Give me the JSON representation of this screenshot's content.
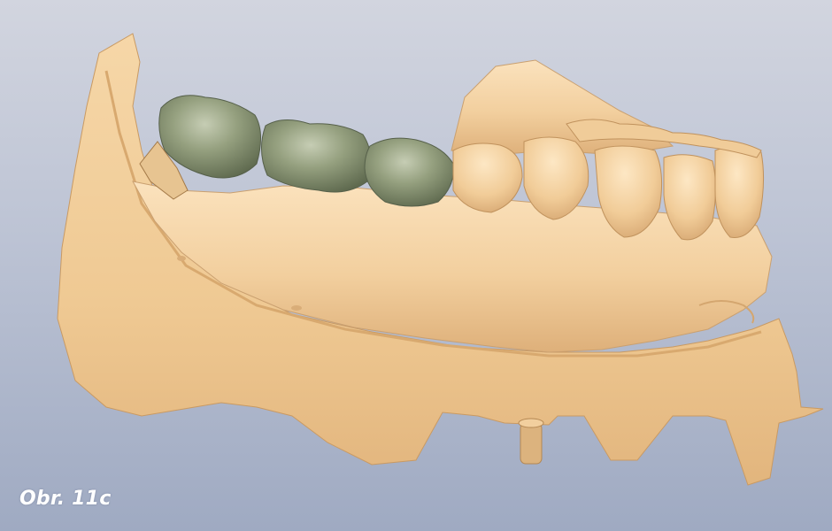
{
  "caption": "Obr. 11c",
  "colors": {
    "background_top": "#d2d5df",
    "background_bottom": "#9faac2",
    "model": "#f2cf9e",
    "model_shadow": "#d6aa77",
    "crowns": "#8e9a7a",
    "crowns_shadow": "#5f6a4f",
    "caption": "#ffffff"
  },
  "scene": {
    "description_icon": "dental-model-3d-scan-icon"
  }
}
